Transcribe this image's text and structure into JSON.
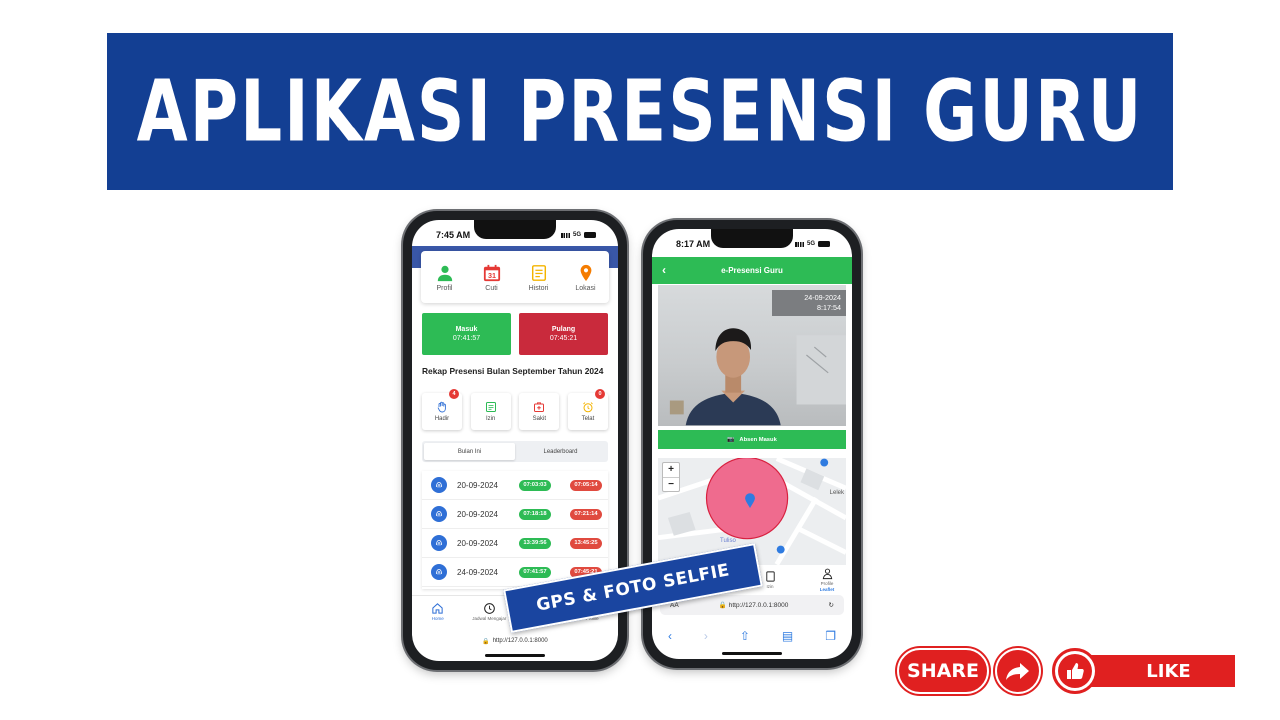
{
  "banner": {
    "title": "APLIKASI PRESENSI GURU"
  },
  "phone1": {
    "time": "7:45 AM",
    "network": "5G",
    "menu": [
      {
        "label": "Profil",
        "icon": "person-icon",
        "color": "#2dbb55"
      },
      {
        "label": "Cuti",
        "icon": "calendar-icon",
        "color": "#e53935",
        "day": "31"
      },
      {
        "label": "Histori",
        "icon": "document-icon",
        "color": "#f4b400"
      },
      {
        "label": "Lokasi",
        "icon": "location-pin-icon",
        "color": "#f57c00"
      }
    ],
    "masuk": {
      "label": "Masuk",
      "time": "07:41:57"
    },
    "pulang": {
      "label": "Pulang",
      "time": "07:45:21"
    },
    "rekap_title": "Rekap Presensi Bulan September Tahun 2024",
    "stats": [
      {
        "label": "Hadir",
        "badge": "4",
        "icon": "hand-icon"
      },
      {
        "label": "Izin",
        "badge": "",
        "icon": "note-icon"
      },
      {
        "label": "Sakit",
        "badge": "",
        "icon": "medical-icon"
      },
      {
        "label": "Telat",
        "badge": "0",
        "icon": "alarm-icon"
      }
    ],
    "tabs": [
      "Bulan Ini",
      "Leaderboard"
    ],
    "history": [
      {
        "date": "20-09-2024",
        "in": "07:03:03",
        "out": "07:05:14"
      },
      {
        "date": "20-09-2024",
        "in": "07:18:18",
        "out": "07:21:14"
      },
      {
        "date": "20-09-2024",
        "in": "13:39:56",
        "out": "13:45:25"
      },
      {
        "date": "24-09-2024",
        "in": "07:41:57",
        "out": "07:45:21"
      }
    ],
    "nav": [
      {
        "label": "Home",
        "icon": "home-icon"
      },
      {
        "label": "Jadwal Mengajar",
        "icon": "clock-icon"
      },
      {
        "label": "Izin",
        "icon": "document-icon"
      },
      {
        "label": "Profile",
        "icon": "user-icon"
      }
    ],
    "url": "http://127.0.0.1:8000"
  },
  "phone2": {
    "time": "8:17 AM",
    "network": "5G",
    "header_title": "e-Presensi Guru",
    "cam_date": "24-09-2024",
    "cam_time": "8:17:54",
    "absen_button": "Absen Masuk",
    "map_labels": {
      "place": "Tuliso",
      "edge": "Lelek"
    },
    "zoom_in": "+",
    "zoom_out": "−",
    "nav": [
      {
        "label": "Izin",
        "icon": "document-icon"
      },
      {
        "label": "Profile",
        "icon": "user-icon"
      }
    ],
    "attribution": "Leaflet",
    "text_size": "AA",
    "url": "http://127.0.0.1:8000"
  },
  "ribbon": {
    "text": "GPS & FOTO SELFIE"
  },
  "social": {
    "share": "SHARE",
    "like": "LIKE",
    "accent": "#e02020"
  },
  "colors": {
    "banner": "#133f93",
    "green": "#2dbb55",
    "red": "#c92a3c"
  }
}
